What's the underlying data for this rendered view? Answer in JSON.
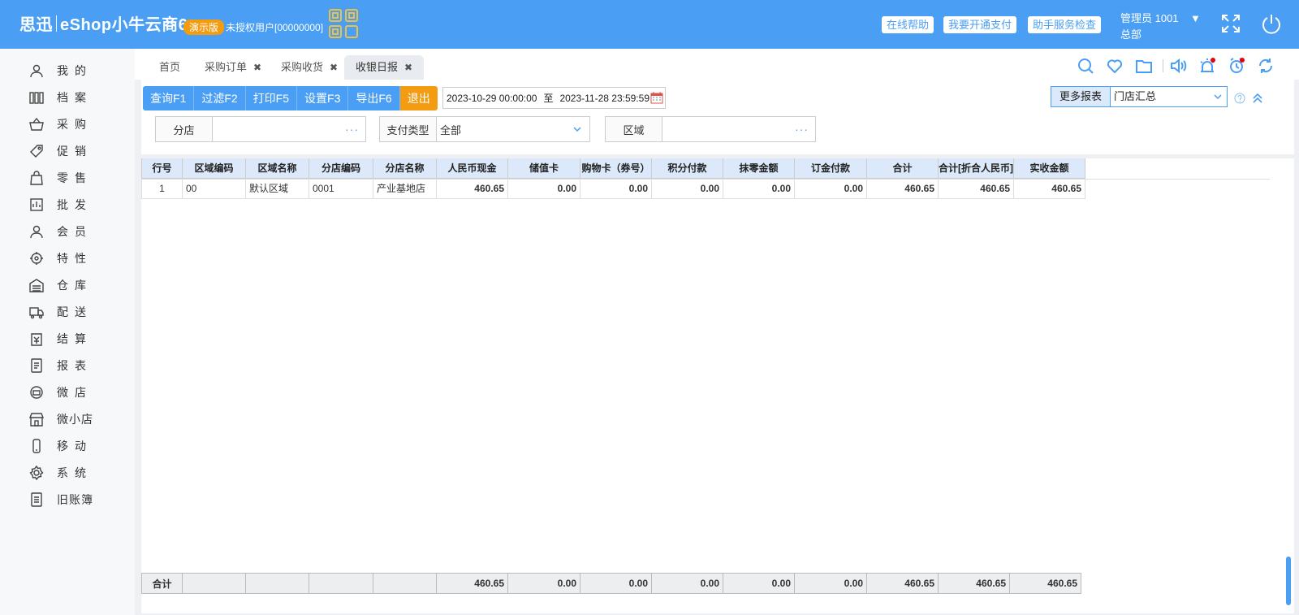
{
  "header": {
    "logo_cn": "思迅",
    "logo_product": "eShop小牛云商6",
    "demo_badge": "演示版",
    "unauthorized": "未授权用户[00000000]",
    "buttons": [
      "在线帮助",
      "我要开通支付",
      "助手服务检查"
    ],
    "user_name": "管理员 1001",
    "user_caret": "▼",
    "org": "总部"
  },
  "sidebar": {
    "items": [
      {
        "label": "我的",
        "icon": "user-icon"
      },
      {
        "label": "档案",
        "icon": "archive-icon"
      },
      {
        "label": "采购",
        "icon": "basket-icon"
      },
      {
        "label": "促销",
        "icon": "tag-icon"
      },
      {
        "label": "零售",
        "icon": "bag-icon"
      },
      {
        "label": "批发",
        "icon": "wholesale-icon"
      },
      {
        "label": "会员",
        "icon": "member-icon"
      },
      {
        "label": "特性",
        "icon": "target-icon"
      },
      {
        "label": "仓库",
        "icon": "warehouse-icon"
      },
      {
        "label": "配送",
        "icon": "truck-icon"
      },
      {
        "label": "结算",
        "icon": "settle-icon"
      },
      {
        "label": "报表",
        "icon": "report-icon"
      },
      {
        "label": "微店",
        "icon": "microshop-icon"
      },
      {
        "label": "微小店",
        "icon": "store-icon"
      },
      {
        "label": "移动",
        "icon": "mobile-icon"
      },
      {
        "label": "系统",
        "icon": "gear-icon"
      },
      {
        "label": "旧账簿",
        "icon": "ledger-icon"
      }
    ]
  },
  "tabs": [
    {
      "label": "首页",
      "closable": false
    },
    {
      "label": "采购订单",
      "closable": true
    },
    {
      "label": "采购收货",
      "closable": true
    },
    {
      "label": "收银日报",
      "closable": true,
      "active": true
    }
  ],
  "tab_close_glyph": "✖",
  "toolbar": {
    "buttons": [
      "查询F1",
      "过滤F2",
      "打印F5",
      "设置F3",
      "导出F6",
      "退出"
    ],
    "date_from": "2023-10-29 00:00:00",
    "date_sep": "至",
    "date_to": "2023-11-28 23:59:59",
    "more_reports_label": "更多报表",
    "more_reports_value": "门店汇总"
  },
  "filters": {
    "branch_label": "分店",
    "branch_value": "",
    "pay_type_label": "支付类型",
    "pay_type_value": "全部",
    "region_label": "区域",
    "region_value": "",
    "dots": "···"
  },
  "grid": {
    "columns": [
      "行号",
      "区域编码",
      "区域名称",
      "分店编码",
      "分店名称",
      "人民币现金",
      "储值卡",
      "购物卡（券号）",
      "积分付款",
      "抹零金额",
      "订金付款",
      "合计",
      "合计[折合人民币]",
      "实收金额"
    ],
    "rows": [
      [
        "1",
        "00",
        "默认区域",
        "0001",
        "产业基地店",
        "460.65",
        "0.00",
        "0.00",
        "0.00",
        "0.00",
        "0.00",
        "460.65",
        "460.65",
        "460.65"
      ]
    ],
    "footer": [
      "合计",
      "",
      "",
      "",
      "",
      "460.65",
      "0.00",
      "0.00",
      "0.00",
      "0.00",
      "0.00",
      "460.65",
      "460.65",
      "460.65"
    ]
  },
  "colors": {
    "brand": "#4a9ff5",
    "exit": "#f39c12",
    "badge": "#f39c12",
    "notify_dot": "#e60012"
  }
}
